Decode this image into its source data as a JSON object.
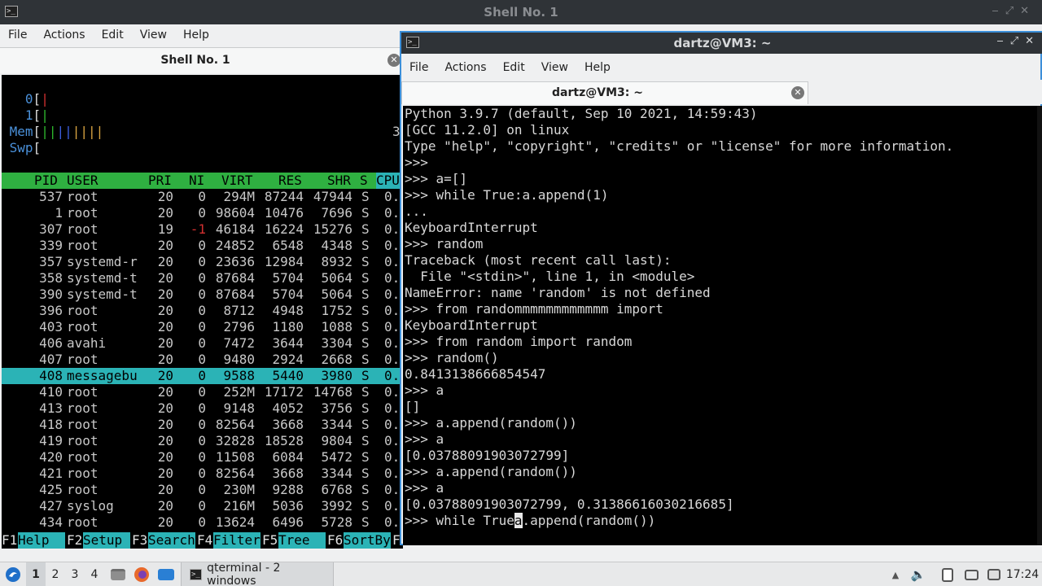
{
  "back_window": {
    "title": "Shell No. 1",
    "menu": [
      "File",
      "Actions",
      "Edit",
      "View",
      "Help"
    ],
    "tab_title": "Shell No. 1",
    "tab_close": "✕"
  },
  "htop": {
    "meters": [
      {
        "label": "0",
        "bracket": "[",
        "bar": "|"
      },
      {
        "label": "1",
        "bracket": "[",
        "bar": "|"
      },
      {
        "label": "Mem",
        "bracket": "[",
        "bar": "||||||||",
        "tail": "3"
      },
      {
        "label": "Swp",
        "bracket": "[",
        "bar": ""
      }
    ],
    "columns": [
      "PID",
      "USER",
      "PRI",
      "NI",
      "VIRT",
      "RES",
      "SHR",
      "S",
      "CPU"
    ],
    "processes": [
      {
        "pid": "537",
        "user": "root",
        "pri": "20",
        "ni": "0",
        "virt": "294M",
        "res": "87244",
        "shr": "47944",
        "s": "S",
        "cpu": "0."
      },
      {
        "pid": "1",
        "user": "root",
        "pri": "20",
        "ni": "0",
        "virt": "98604",
        "res": "10476",
        "shr": "7696",
        "s": "S",
        "cpu": "0."
      },
      {
        "pid": "307",
        "user": "root",
        "pri": "19",
        "ni": "-1",
        "virt": "46184",
        "res": "16224",
        "shr": "15276",
        "s": "S",
        "cpu": "0."
      },
      {
        "pid": "339",
        "user": "root",
        "pri": "20",
        "ni": "0",
        "virt": "24852",
        "res": "6548",
        "shr": "4348",
        "s": "S",
        "cpu": "0."
      },
      {
        "pid": "357",
        "user": "systemd-r",
        "pri": "20",
        "ni": "0",
        "virt": "23636",
        "res": "12984",
        "shr": "8932",
        "s": "S",
        "cpu": "0."
      },
      {
        "pid": "358",
        "user": "systemd-t",
        "pri": "20",
        "ni": "0",
        "virt": "87684",
        "res": "5704",
        "shr": "5064",
        "s": "S",
        "cpu": "0."
      },
      {
        "pid": "390",
        "user": "systemd-t",
        "pri": "20",
        "ni": "0",
        "virt": "87684",
        "res": "5704",
        "shr": "5064",
        "s": "S",
        "cpu": "0."
      },
      {
        "pid": "396",
        "user": "root",
        "pri": "20",
        "ni": "0",
        "virt": "8712",
        "res": "4948",
        "shr": "1752",
        "s": "S",
        "cpu": "0."
      },
      {
        "pid": "403",
        "user": "root",
        "pri": "20",
        "ni": "0",
        "virt": "2796",
        "res": "1180",
        "shr": "1088",
        "s": "S",
        "cpu": "0."
      },
      {
        "pid": "406",
        "user": "avahi",
        "pri": "20",
        "ni": "0",
        "virt": "7472",
        "res": "3644",
        "shr": "3304",
        "s": "S",
        "cpu": "0."
      },
      {
        "pid": "407",
        "user": "root",
        "pri": "20",
        "ni": "0",
        "virt": "9480",
        "res": "2924",
        "shr": "2668",
        "s": "S",
        "cpu": "0."
      },
      {
        "pid": "408",
        "user": "messagebu",
        "pri": "20",
        "ni": "0",
        "virt": "9588",
        "res": "5440",
        "shr": "3980",
        "s": "S",
        "cpu": "0.",
        "selected": true
      },
      {
        "pid": "410",
        "user": "root",
        "pri": "20",
        "ni": "0",
        "virt": "252M",
        "res": "17172",
        "shr": "14768",
        "s": "S",
        "cpu": "0."
      },
      {
        "pid": "413",
        "user": "root",
        "pri": "20",
        "ni": "0",
        "virt": "9148",
        "res": "4052",
        "shr": "3756",
        "s": "S",
        "cpu": "0."
      },
      {
        "pid": "418",
        "user": "root",
        "pri": "20",
        "ni": "0",
        "virt": "82564",
        "res": "3668",
        "shr": "3344",
        "s": "S",
        "cpu": "0."
      },
      {
        "pid": "419",
        "user": "root",
        "pri": "20",
        "ni": "0",
        "virt": "32828",
        "res": "18528",
        "shr": "9804",
        "s": "S",
        "cpu": "0."
      },
      {
        "pid": "420",
        "user": "root",
        "pri": "20",
        "ni": "0",
        "virt": "11508",
        "res": "6084",
        "shr": "5472",
        "s": "S",
        "cpu": "0."
      },
      {
        "pid": "421",
        "user": "root",
        "pri": "20",
        "ni": "0",
        "virt": "82564",
        "res": "3668",
        "shr": "3344",
        "s": "S",
        "cpu": "0."
      },
      {
        "pid": "425",
        "user": "root",
        "pri": "20",
        "ni": "0",
        "virt": "230M",
        "res": "9288",
        "shr": "6768",
        "s": "S",
        "cpu": "0."
      },
      {
        "pid": "427",
        "user": "syslog",
        "pri": "20",
        "ni": "0",
        "virt": "216M",
        "res": "5036",
        "shr": "3992",
        "s": "S",
        "cpu": "0."
      },
      {
        "pid": "434",
        "user": "root",
        "pri": "20",
        "ni": "0",
        "virt": "13624",
        "res": "6496",
        "shr": "5728",
        "s": "S",
        "cpu": "0."
      }
    ],
    "function_keys": [
      {
        "key": "F1",
        "label": "Help  "
      },
      {
        "key": "F2",
        "label": "Setup "
      },
      {
        "key": "F3",
        "label": "Search"
      },
      {
        "key": "F4",
        "label": "Filter"
      },
      {
        "key": "F5",
        "label": "Tree  "
      },
      {
        "key": "F6",
        "label": "SortBy"
      },
      {
        "key": "F",
        "label": ""
      }
    ]
  },
  "front_window": {
    "title": "dartz@VM3: ~",
    "menu": [
      "File",
      "Actions",
      "Edit",
      "View",
      "Help"
    ],
    "tab_title": "dartz@VM3: ~",
    "tab_close": "✕"
  },
  "python_terminal": {
    "lines": [
      "Python 3.9.7 (default, Sep 10 2021, 14:59:43)",
      "[GCC 11.2.0] on linux",
      "Type \"help\", \"copyright\", \"credits\" or \"license\" for more information.",
      ">>>",
      ">>> a=[]",
      ">>> while True:a.append(1)",
      "...",
      "KeyboardInterrupt",
      ">>> random",
      "Traceback (most recent call last):",
      "  File \"<stdin>\", line 1, in <module>",
      "NameError: name 'random' is not defined",
      ">>> from randommmmmmmmmmmm import",
      "KeyboardInterrupt",
      ">>> from random import random",
      ">>> random()",
      "0.8413138666854547",
      ">>> a",
      "[]",
      ">>> a.append(random())",
      ">>> a",
      "[0.03788091903072799]",
      ">>> a.append(random())",
      ">>> a",
      "[0.03788091903072799, 0.31386616030216685]"
    ],
    "input_before_cursor": ">>> while True",
    "cursor_char": "a",
    "input_after_cursor": ".append(random())"
  },
  "taskbar": {
    "desktops": [
      "1",
      "2",
      "3",
      "4"
    ],
    "active_desktop": "1",
    "task_label": "qterminal - 2 windows",
    "clock": "17:24"
  },
  "colors": {
    "htop_header_bg": "#2fb041",
    "htop_selected_bg": "#2bb3b6",
    "terminal_bg": "#000000",
    "focus_border": "#3c8fd9",
    "titlebar_bg": "#2f3337"
  },
  "icons": [
    "terminal-icon",
    "minimize-icon",
    "maximize-icon",
    "close-icon",
    "start-menu-icon",
    "files-icon",
    "firefox-icon",
    "desktop-icon",
    "volume-icon",
    "clipboard-icon",
    "network-icon",
    "notifications-icon"
  ]
}
